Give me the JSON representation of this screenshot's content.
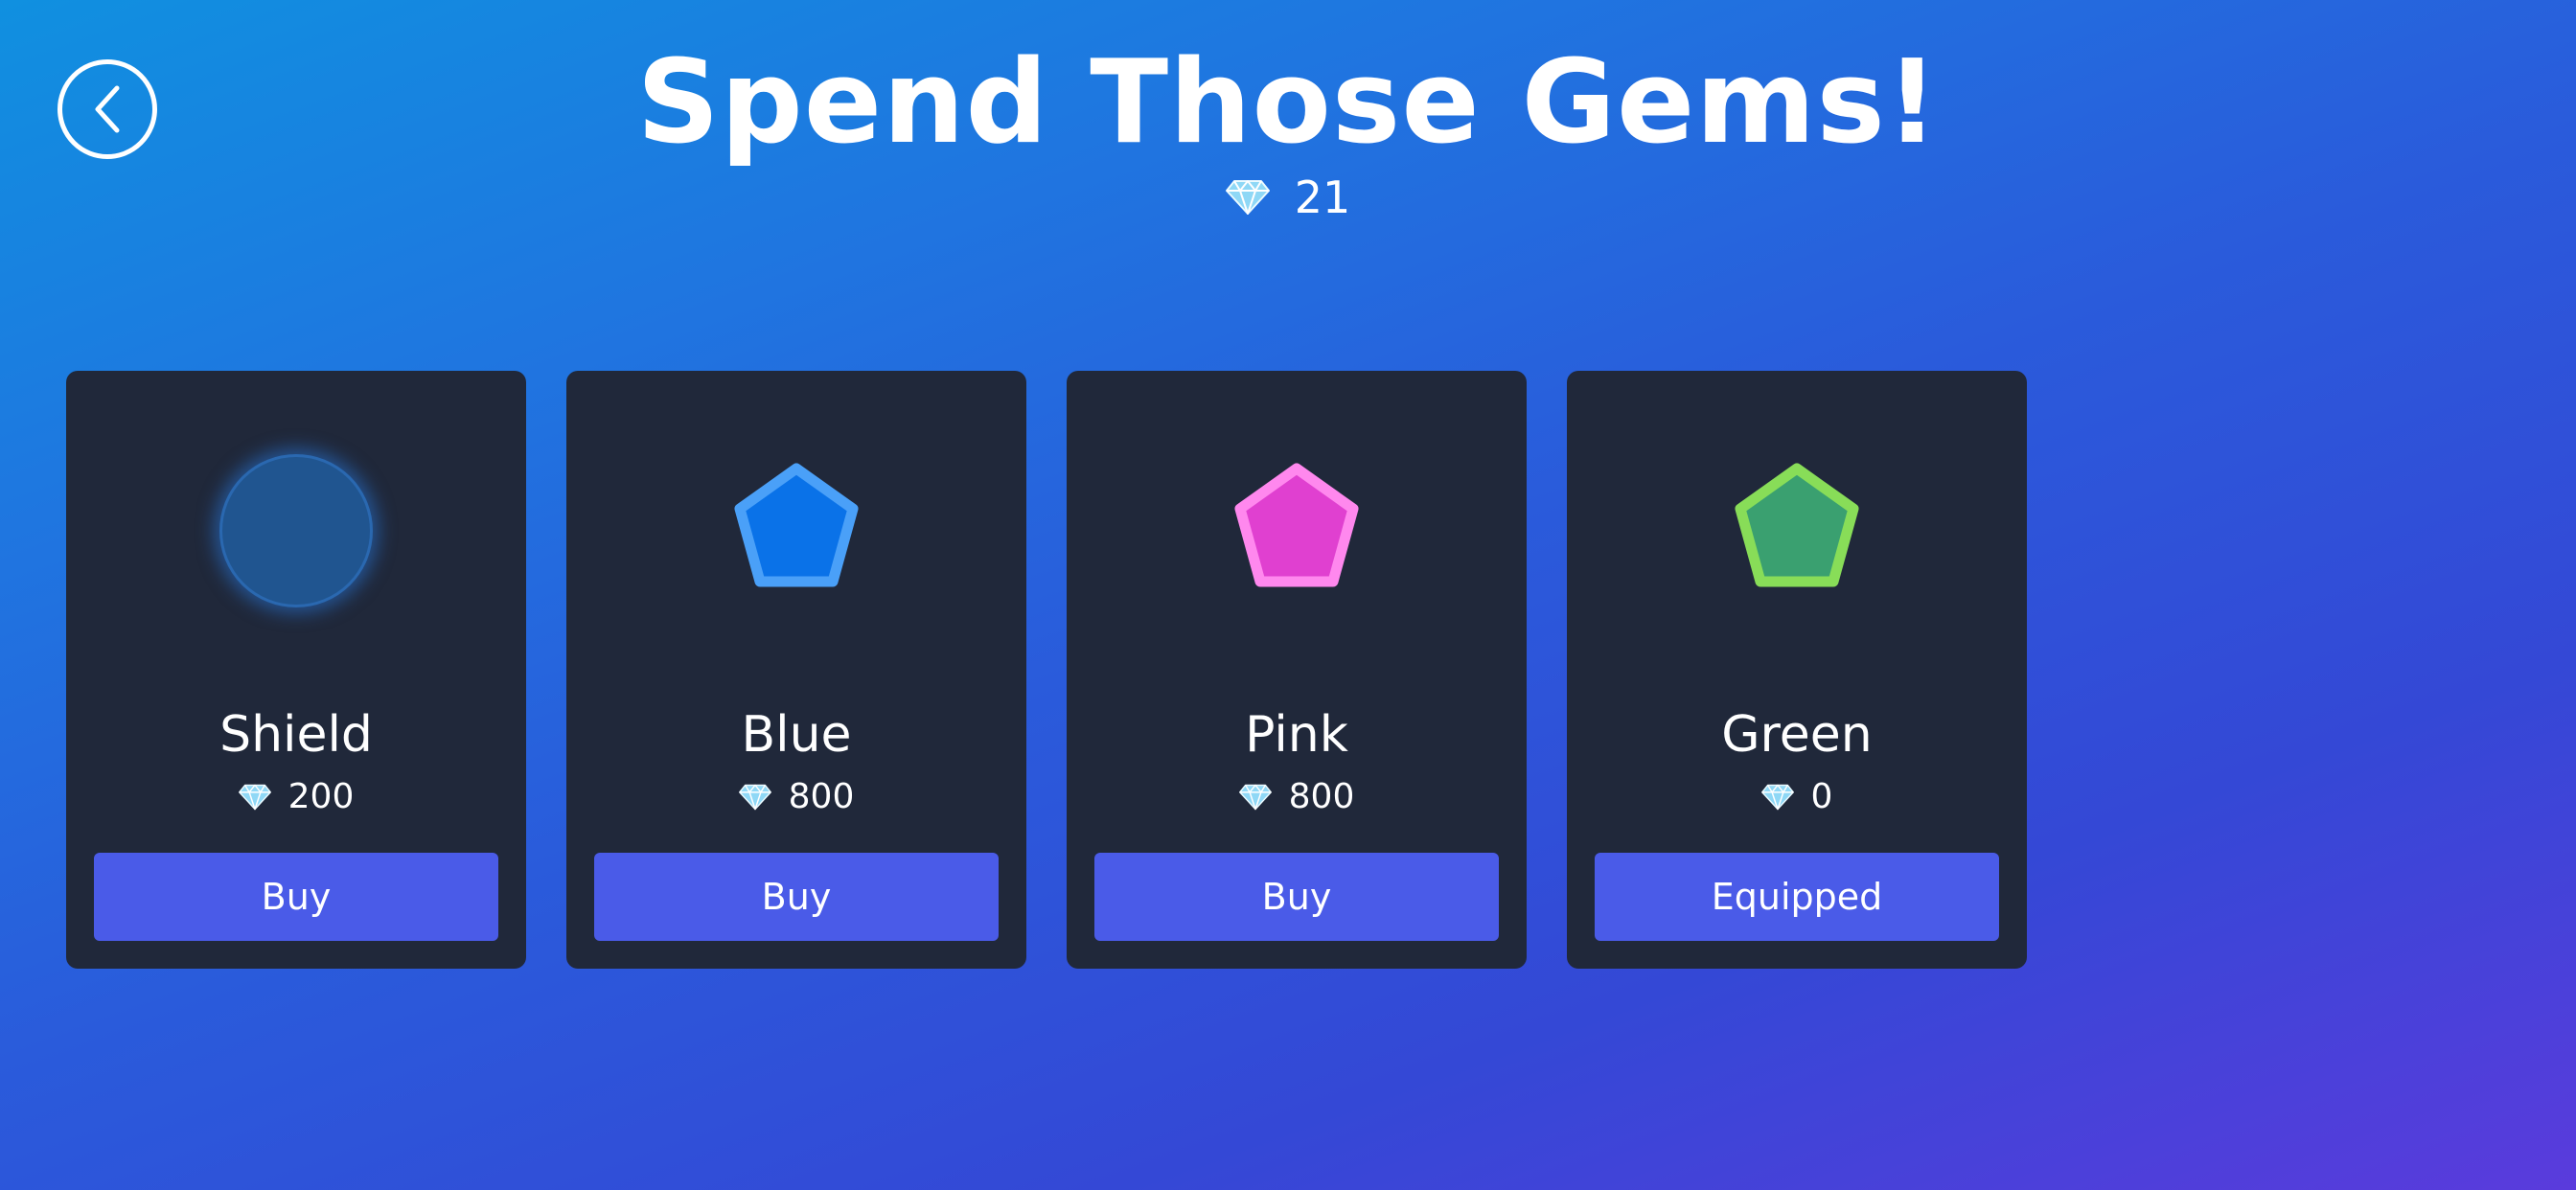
{
  "header": {
    "title": "Spend Those Gems!",
    "gem_balance": "21",
    "back_icon": "chevron-left-icon"
  },
  "colors": {
    "card_background": "#20283a",
    "button_background": "#4a5be8",
    "gem_icon": "#8fd8f6"
  },
  "items": [
    {
      "name": "Shield",
      "price": "200",
      "button_label": "Buy",
      "icon": "shield-orb",
      "fill": "#205590",
      "stroke": "#2a68b0"
    },
    {
      "name": "Blue",
      "price": "800",
      "button_label": "Buy",
      "icon": "pentagon",
      "fill": "#0a72e8",
      "stroke": "#4aa0f8"
    },
    {
      "name": "Pink",
      "price": "800",
      "button_label": "Buy",
      "icon": "pentagon",
      "fill": "#e040d0",
      "stroke": "#ff88ee"
    },
    {
      "name": "Green",
      "price": "0",
      "button_label": "Equipped",
      "icon": "pentagon",
      "fill": "#3aa070",
      "stroke": "#88dd58"
    }
  ]
}
